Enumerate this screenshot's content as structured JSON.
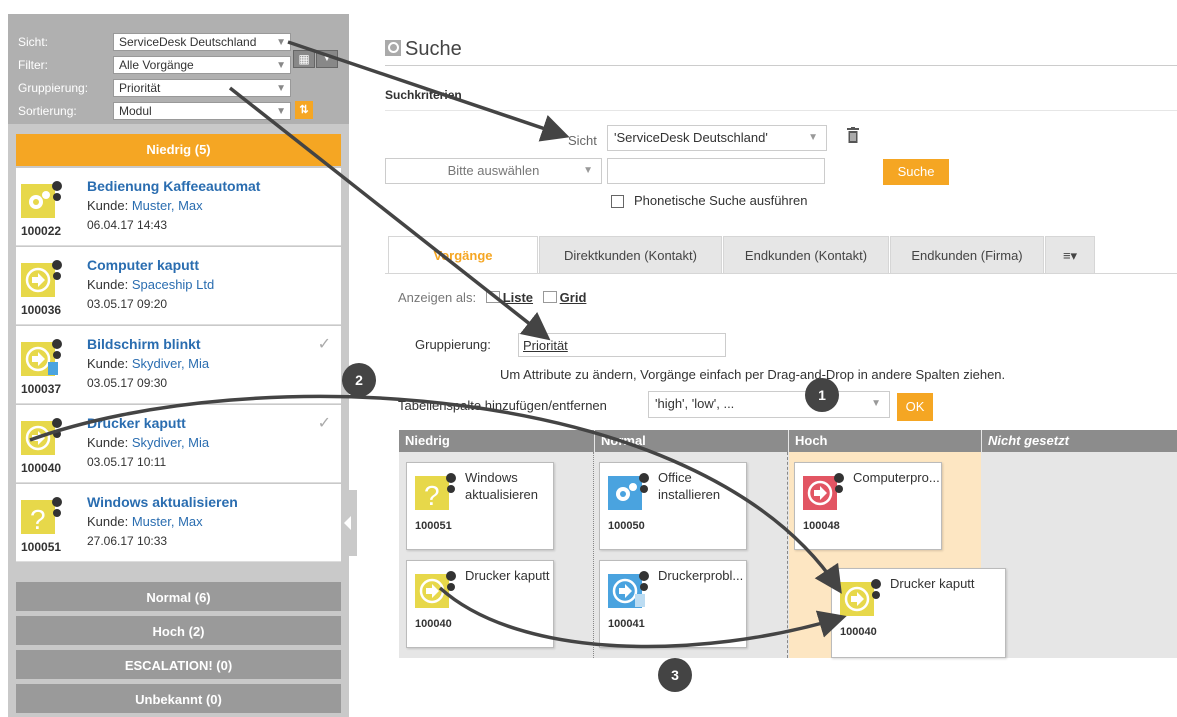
{
  "left_panel": {
    "filters": [
      {
        "label": "Sicht:",
        "value": "ServiceDesk Deutschland"
      },
      {
        "label": "Filter:",
        "value": "Alle Vorgänge"
      },
      {
        "label": "Gruppierung:",
        "value": "Priorität"
      },
      {
        "label": "Sortierung:",
        "value": "Modul"
      }
    ],
    "groups": {
      "niedrig": "Niedrig (5)",
      "normal": "Normal (6)",
      "hoch": "Hoch (2)",
      "escalation": "ESCALATION! (0)",
      "unbekannt": "Unbekannt (0)"
    },
    "cards": [
      {
        "number": "100022",
        "title": "Bedienung Kaffeeautomat",
        "customer_label": "Kunde:",
        "customer": "Muster, Max",
        "date": "06.04.17 14:43",
        "icon": "gear-icon"
      },
      {
        "number": "100036",
        "title": "Computer kaputt",
        "customer_label": "Kunde:",
        "customer": "Spaceship Ltd",
        "date": "03.05.17 09:20",
        "icon": "arrow-circle-icon"
      },
      {
        "number": "100037",
        "title": "Bildschirm blinkt",
        "customer_label": "Kunde:",
        "customer": "Skydiver, Mia",
        "date": "03.05.17 09:30",
        "icon": "arrow-circle-icon"
      },
      {
        "number": "100040",
        "title": "Drucker kaputt",
        "customer_label": "Kunde:",
        "customer": "Skydiver, Mia",
        "date": "03.05.17 10:11",
        "icon": "arrow-circle-icon"
      },
      {
        "number": "100051",
        "title": "Windows aktualisieren",
        "customer_label": "Kunde:",
        "customer": "Muster, Max",
        "date": "27.06.17 10:33",
        "icon": "question-icon"
      }
    ]
  },
  "main": {
    "title": "Suche",
    "section": "Suchkriterien",
    "sicht_label": "Sicht",
    "sicht_value": "'ServiceDesk Deutschland'",
    "select_placeholder": "Bitte auswählen",
    "search_button": "Suche",
    "phonetic_label": "Phonetische Suche ausführen",
    "tabs": [
      "Vorgänge",
      "Direktkunden (Kontakt)",
      "Endkunden (Kontakt)",
      "Endkunden (Firma)"
    ],
    "show_as": "Anzeigen als:",
    "view_list": "Liste",
    "view_grid": "Grid",
    "grouping_label": "Gruppierung:",
    "grouping_value": "Priorität",
    "hint": "Um Attribute zu ändern, Vorgänge einfach per Drag-and-Drop in andere Spalten ziehen.",
    "column_label": "Tabellenspalte hinzufügen/entfernen",
    "column_value": "'high', 'low',  ...",
    "ok_button": "OK",
    "board": {
      "columns": [
        "Niedrig",
        "Normal",
        "Hoch",
        "Nicht gesetzt"
      ],
      "cards": {
        "c100051": {
          "text": "Windows aktualisieren",
          "number": "100051"
        },
        "c100050": {
          "text": "Office installieren",
          "number": "100050"
        },
        "c100048": {
          "text": "Computerpro...",
          "number": "100048"
        },
        "c100040": {
          "text": "Drucker kaputt",
          "number": "100040"
        },
        "c100041": {
          "text": "Druckerprobl...",
          "number": "100041"
        },
        "c100040_drag": {
          "text": "Drucker kaputt",
          "number": "100040"
        }
      }
    },
    "badges": [
      "1",
      "2",
      "3"
    ]
  },
  "colors": {
    "accent": "#f5a623",
    "link": "#2a6db0",
    "yellow_icon": "#e7d84a",
    "blue_icon": "#4aa3df",
    "red_icon": "#e25563"
  }
}
